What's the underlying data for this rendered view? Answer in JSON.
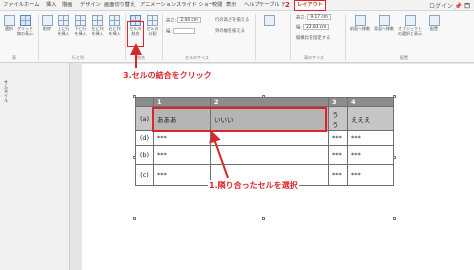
{
  "ribbon_tabs": [
    "ファイル",
    "ホーム",
    "挿入",
    "描画",
    "デザイン",
    "画面切り替え",
    "アニメーション",
    "スライド ショー",
    "校閲",
    "表示",
    "ヘルプ",
    "テーブル デザイン",
    "レイアウト"
  ],
  "active_tab": "レイアウト",
  "window_controls": "ログイン 📌 🗖",
  "step2_label": "2",
  "ribbon": {
    "select_label": "選択",
    "gridlines_label": "グリッド線の表示",
    "delete_label": "削除",
    "insert_above": "上に行を挿入",
    "insert_below": "下に行を挿入",
    "insert_left": "左に列を挿入",
    "insert_right": "右に列を挿入",
    "merge_cells": "セルの結合",
    "split_cells": "セルの分割",
    "height_label": "高さ:",
    "height_value": "2.04 cm",
    "width_label": "幅:",
    "width_value": "",
    "distribute_rows": "行の高さを揃える",
    "distribute_cols": "列の幅を揃える",
    "table_height_label": "高さ:",
    "table_height_value": "9.17 cm",
    "table_width_label": "幅:",
    "table_width_value": "22.83 cm",
    "lock_aspect": "縦横比を固定する",
    "bring_forward": "前面へ移動",
    "send_backward": "背面へ移動",
    "selection_pane": "オブジェクトの選択と表示",
    "align": "配置",
    "group_table": "表",
    "group_rows_cols": "行と列",
    "group_merge": "結合",
    "group_cell_size": "セルのサイズ",
    "group_table_size": "表のサイズ",
    "group_arrange": "配置"
  },
  "thumbnails_label": "サムネイル",
  "annotations": {
    "step3": "3.セルの結合をクリック",
    "step1": "1.隣り合ったセルを選択"
  },
  "table": {
    "header": [
      "",
      "1",
      "2",
      "3",
      "4"
    ],
    "rows": [
      [
        "(a)",
        "あああ",
        "いいい",
        "うう",
        "えええ"
      ],
      [
        "(d)",
        "***",
        "",
        "***",
        "***"
      ],
      [
        "(b)",
        "***",
        "",
        "***",
        "***"
      ],
      [
        "(c)",
        "***",
        "",
        "***",
        "***"
      ]
    ]
  },
  "colors": {
    "accent_red": "#d9262d",
    "header_gray": "#8c8c8c",
    "selected_row_gray": "#c6c6c6"
  }
}
